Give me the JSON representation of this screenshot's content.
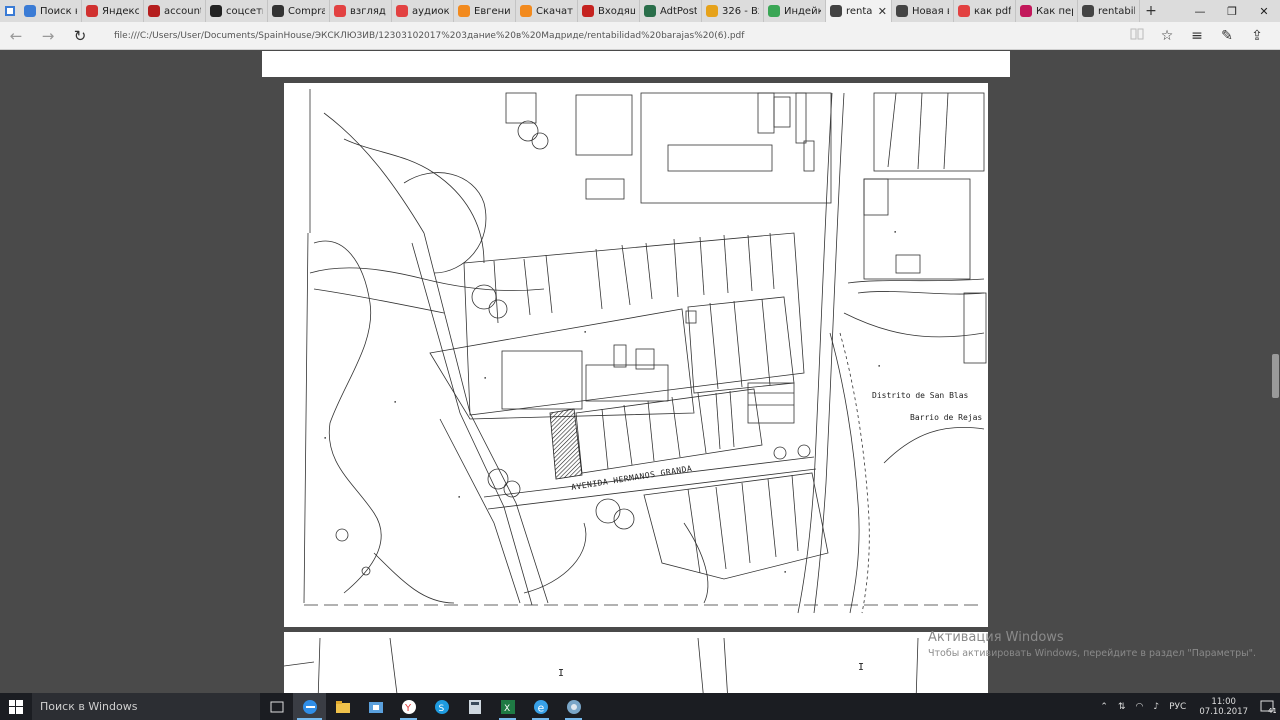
{
  "browser": {
    "tabs": [
      {
        "label": "Поиск н",
        "icon": "edge-blue-icon",
        "color": "#3a7bd5"
      },
      {
        "label": "Яндекс.Г",
        "icon": "yandex-icon",
        "color": "#d0302f"
      },
      {
        "label": "account.l",
        "icon": "lastpass-icon",
        "color": "#b51e1e"
      },
      {
        "label": "соцсети",
        "icon": "m-icon",
        "color": "#222222"
      },
      {
        "label": "Comprar",
        "icon": "fc-icon",
        "color": "#333333"
      },
      {
        "label": "взгляд и",
        "icon": "yandex-icon",
        "color": "#e24141"
      },
      {
        "label": "аудиокні",
        "icon": "yandex-icon",
        "color": "#e24141"
      },
      {
        "label": "Евгений",
        "icon": "orange-icon",
        "color": "#f28a1e"
      },
      {
        "label": "Скачать",
        "icon": "orange-icon",
        "color": "#f28a1e"
      },
      {
        "label": "Входящ",
        "icon": "gmail-icon",
        "color": "#c5221f"
      },
      {
        "label": "AdtPosta",
        "icon": "gear-icon",
        "color": "#2a6e4a"
      },
      {
        "label": "326 - Вхс",
        "icon": "triangle-icon",
        "color": "#e6a21a"
      },
      {
        "label": "Индейка",
        "icon": "leaf-icon",
        "color": "#3aa655"
      },
      {
        "label": "renta",
        "icon": "reading-icon",
        "color": "#444444",
        "active": true
      },
      {
        "label": "Новая вї",
        "icon": "newtab-icon",
        "color": "#444444"
      },
      {
        "label": "как pdf r",
        "icon": "yandex-icon",
        "color": "#e24141"
      },
      {
        "label": "Как пере",
        "icon": "pink-icon",
        "color": "#c2185b"
      },
      {
        "label": "rentabilic",
        "icon": "reading-icon",
        "color": "#444444"
      }
    ],
    "new_tab_symbol": "+",
    "window_controls": {
      "minimize": "—",
      "maximize": "❐",
      "close": "✕"
    },
    "url": "file:///C:/Users/User/Documents/SpainHouse/ЭКСКЛЮЗИВ/12303102017%203дание%20в%20Мадриде/rentabilidad%20barajas%20(6).pdf",
    "nav": {
      "back": "←",
      "forward": "→",
      "refresh": "↻"
    },
    "addr_icons": {
      "reading_view": "📖",
      "favorite": "☆",
      "hub": "≡",
      "notes": "✎",
      "share": "⇪"
    }
  },
  "document": {
    "map_labels": {
      "district": "Distrito de San Blas",
      "barrio": "Barrio de Rejas",
      "street": "AVENIDA HERMANOS GRANDA"
    },
    "next_page_marks": [
      "I",
      "I"
    ]
  },
  "watermark": {
    "title": "Активация Windows",
    "subtitle": "Чтобы активировать Windows, перейдите в раздел \"Параметры\"."
  },
  "taskbar": {
    "search_placeholder": "Поиск в Windows",
    "tray": {
      "lang": "РУС",
      "time": "11:00",
      "date": "07.10.2017",
      "notif_count": "41"
    }
  }
}
